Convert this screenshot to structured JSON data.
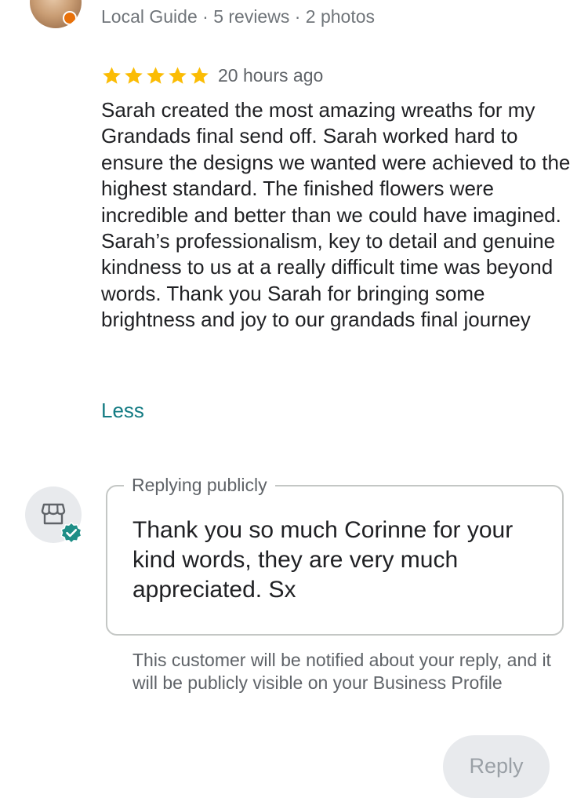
{
  "reviewer": {
    "meta": "Local Guide · 5 reviews · 2 photos"
  },
  "review": {
    "rating": 5,
    "max_rating": 5,
    "time": "20 hours ago",
    "paragraphs": [
      "Sarah created the most amazing wreaths for my Grandads final send off. Sarah worked hard to ensure the designs we wanted were achieved to the highest standard. The finished flowers were incredible and better than we could have imagined.",
      "Sarah’s professionalism, key to detail and genuine kindness to us at a really difficult time was beyond words. Thank you Sarah for bringing some brightness and joy to our grandads final journey"
    ],
    "less_label": "Less"
  },
  "reply": {
    "legend": "Replying publicly",
    "text": "Thank you so much Corinne for your kind words, they are very much appreciated. Sx",
    "notice": "This customer will be notified about your reply, and it will be publicly visible on your Business Profile",
    "button_label": "Reply"
  },
  "colors": {
    "star": "#fbbc04",
    "link": "#137b83",
    "verified": "#1e8e87"
  }
}
